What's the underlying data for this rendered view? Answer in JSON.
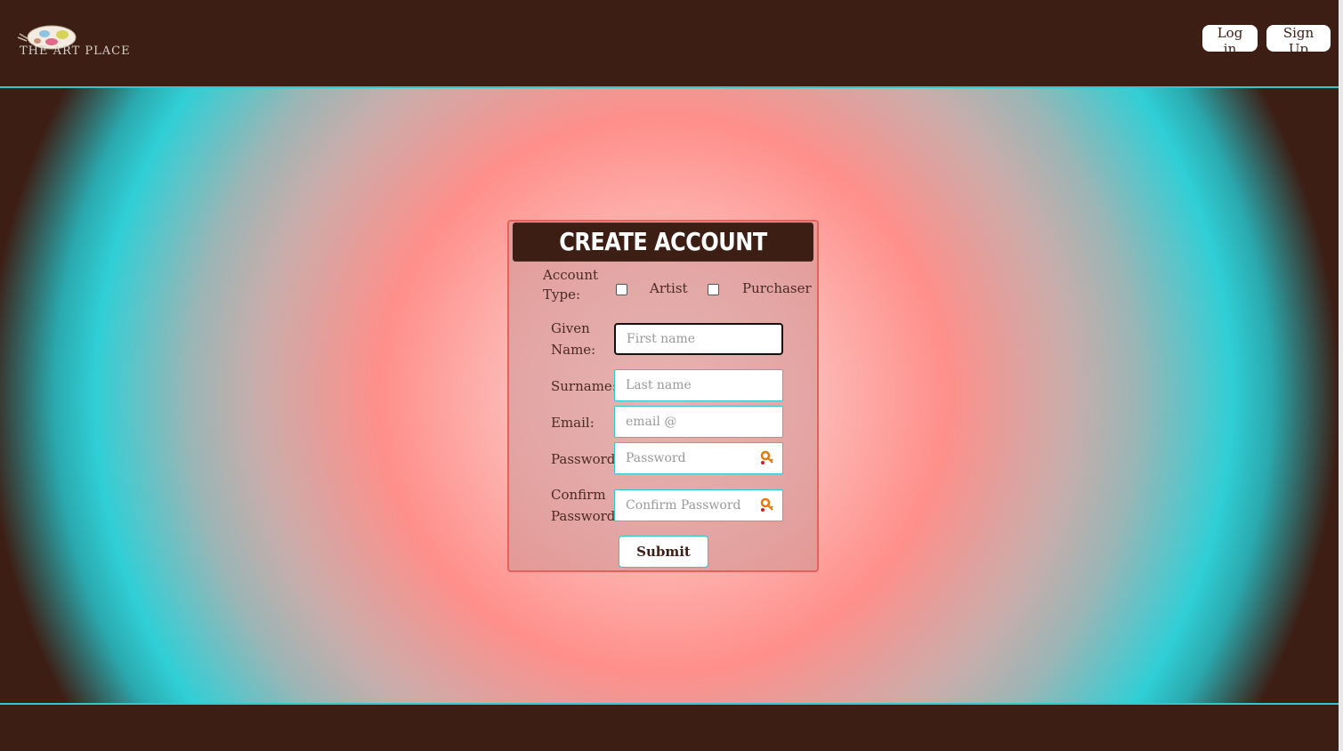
{
  "header": {
    "logo_text": "THE ART PLACE",
    "login_label": "Log in",
    "signup_label": "Sign Up"
  },
  "form": {
    "title": "CREATE ACCOUNT",
    "account_type_label_1": "Account",
    "account_type_label_2": "Type:",
    "artist_label": "Artist",
    "purchaser_label": "Purchaser",
    "artist_checked": false,
    "purchaser_checked": false,
    "given_name_label_1": "Given",
    "given_name_label_2": "Name:",
    "given_name_placeholder": "First name",
    "given_name_value": "",
    "surname_label": "Surname:",
    "surname_placeholder": "Last name",
    "email_label": "Email:",
    "email_placeholder": "email @",
    "password_label": "Password:",
    "password_placeholder": "Password",
    "confirm_label_1": "Confirm",
    "confirm_label_2": "Password:",
    "confirm_placeholder": "Confirm Password",
    "submit_label": "Submit"
  },
  "colors": {
    "brand_dark": "#3c1e15",
    "teal": "#30c8cf",
    "coral": "#ff8f8a",
    "card_border": "#e8605c"
  },
  "icons": {
    "password_key": "key-icon",
    "confirm_key": "key-icon"
  }
}
